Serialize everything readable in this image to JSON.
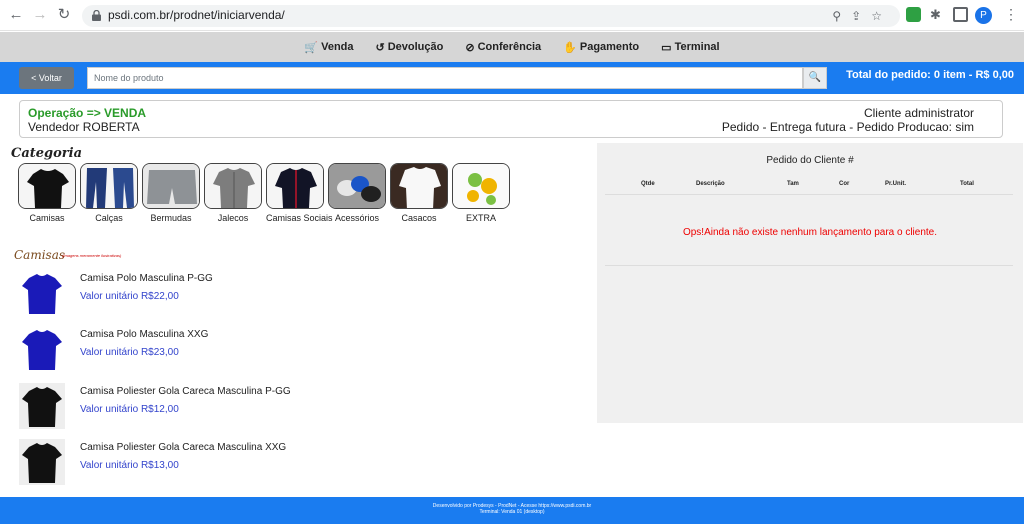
{
  "browser": {
    "url": "psdi.com.br/prodnet/iniciarvenda/",
    "profile_initial": "P"
  },
  "topnav": [
    {
      "label": "Venda",
      "icon": "cart-icon"
    },
    {
      "label": "Devolução",
      "icon": "undo-icon"
    },
    {
      "label": "Conferência",
      "icon": "check-circle-icon"
    },
    {
      "label": "Pagamento",
      "icon": "hand-money-icon"
    },
    {
      "label": "Terminal",
      "icon": "laptop-icon"
    }
  ],
  "toolbar": {
    "back_label": "< Voltar",
    "search_placeholder": "Nome do produto",
    "total_label": "Total do pedido: 0 item - R$ 0,00"
  },
  "operation": {
    "title": "Operação => VENDA",
    "seller": "Vendedor ROBERTA",
    "client": "Cliente administrator",
    "pedido": "Pedido - Entrega futura - Pedido Producao: sim"
  },
  "categories_title": "Categoria",
  "categories": [
    {
      "label": "Camisas",
      "icon": "tshirt-icon"
    },
    {
      "label": "Calças",
      "icon": "jeans-icon"
    },
    {
      "label": "Bermudas",
      "icon": "shorts-icon"
    },
    {
      "label": "Jalecos",
      "icon": "jacket-icon"
    },
    {
      "label": "Camisas Sociais",
      "icon": "dress-shirt-icon"
    },
    {
      "label": "Acessórios",
      "icon": "caps-icon"
    },
    {
      "label": "Casacos",
      "icon": "coat-icon"
    },
    {
      "label": "EXTRA",
      "icon": "coins-icon"
    }
  ],
  "section": {
    "title": "Camisas",
    "note": "(Imagens meramente ilustrativas)"
  },
  "products": [
    {
      "name": "Camisa Polo Masculina P-GG",
      "price": "Valor unitário R$22,00",
      "color": "#1a1ab8"
    },
    {
      "name": "Camisa Polo Masculina XXG",
      "price": "Valor unitário R$23,00",
      "color": "#1a1ab8"
    },
    {
      "name": "Camisa Poliester Gola Careca Masculina P-GG",
      "price": "Valor unitário R$12,00",
      "color": "#111111"
    },
    {
      "name": "Camisa Poliester Gola Careca Masculina XXG",
      "price": "Valor unitário R$13,00",
      "color": "#111111"
    }
  ],
  "order_panel": {
    "title": "Pedido do Cliente #",
    "columns": [
      "Qtde",
      "Descrição",
      "Tam",
      "Cor",
      "Pr.Unit.",
      "Total"
    ],
    "empty_message": "Ops!Ainda não existe nenhum lançamento para o cliente."
  },
  "footer": {
    "line1": "Desenvolvido por Prodesys - ProdNet - Acesse https://www.psdi.com.br",
    "line2": "Terminal: Venda 01 (desktop)"
  }
}
